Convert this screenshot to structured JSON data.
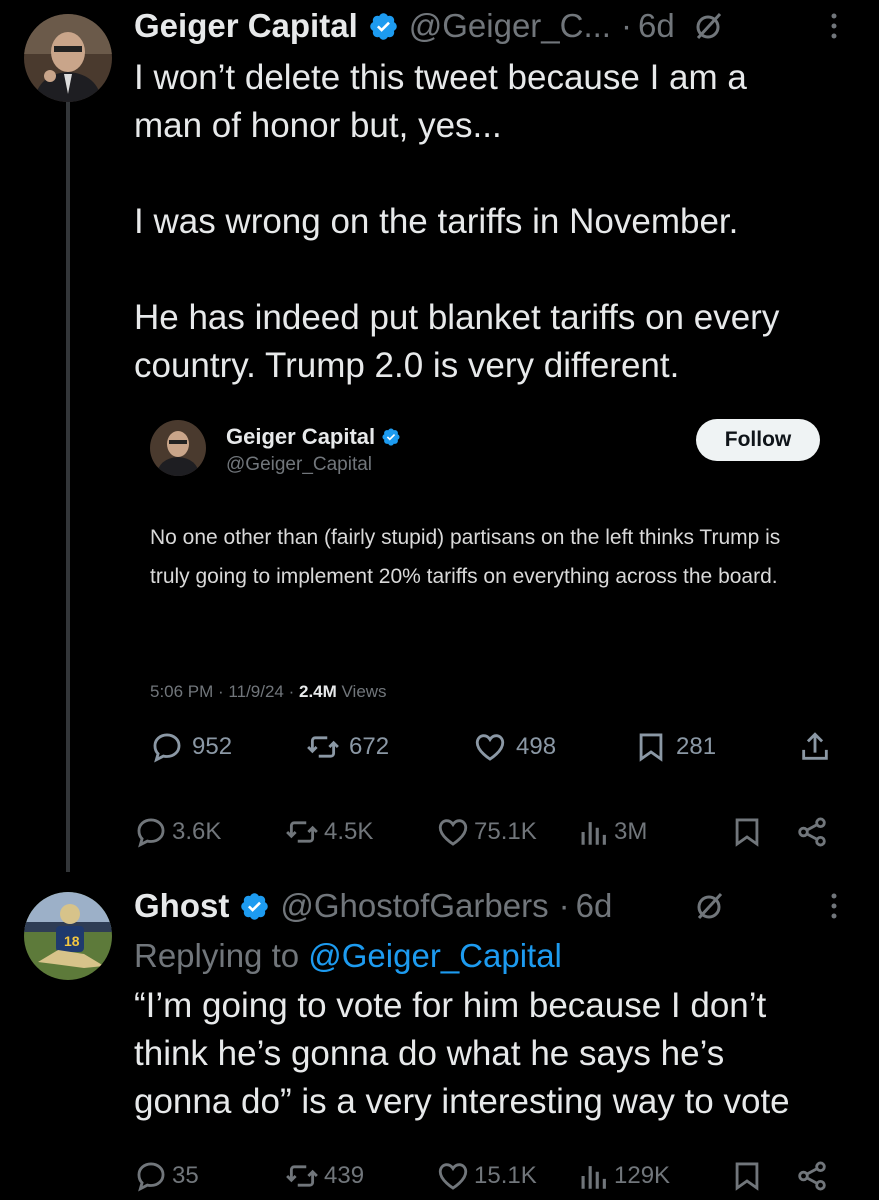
{
  "tweet1": {
    "name": "Geiger Capital",
    "handle": "@Geiger_C...",
    "separator": "·",
    "time": "6d",
    "text": "I won’t delete this tweet because I am a\nman of honor but, yes...\n\nI was wrong on the tariffs in November.\n\nHe has indeed put blanket tariffs on every\ncountry. Trump 2.0 is very different.",
    "stats": {
      "replies": "3.6K",
      "reposts": "4.5K",
      "likes": "75.1K",
      "views": "3M"
    }
  },
  "quoted": {
    "name": "Geiger Capital",
    "handle": "@Geiger_Capital",
    "follow_label": "Follow",
    "text": "No one other than (fairly stupid) partisans on the left thinks Trump is truly going to implement 20% tariffs on everything across the board.",
    "meta_time": "5:06 PM · 11/9/24 · ",
    "meta_views_count": "2.4M",
    "meta_views_label": " Views",
    "stats": {
      "replies": "952",
      "reposts": "672",
      "likes": "498",
      "bookmarks": "281"
    }
  },
  "tweet2": {
    "name": "Ghost",
    "handle": "@GhostofGarbers",
    "separator": "·",
    "time": "6d",
    "replying_prefix": "Replying to ",
    "replying_handle": "@Geiger_Capital",
    "text": "“I’m going to vote for him because I don’t\nthink he’s gonna do what he says he’s\ngonna do” is a very interesting way to vote",
    "stats": {
      "replies": "35",
      "reposts": "439",
      "likes": "15.1K",
      "views": "129K"
    }
  },
  "colors": {
    "background": "#000000",
    "text": "#e7e9ea",
    "muted": "#71767b",
    "accent": "#1d9bf0"
  },
  "icons": [
    "verified-badge-icon",
    "grok-icon",
    "more-icon",
    "reply-icon",
    "repost-icon",
    "like-icon",
    "views-icon",
    "bookmark-icon",
    "share-icon"
  ]
}
